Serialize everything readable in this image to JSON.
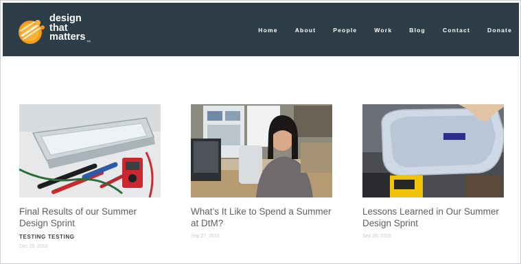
{
  "brand": {
    "logo_lines": [
      "design",
      "that",
      "matters"
    ],
    "trademark": "™"
  },
  "nav": {
    "items": [
      "Home",
      "About",
      "People",
      "Work",
      "Blog",
      "Contact",
      "Donate"
    ]
  },
  "posts": [
    {
      "title": "Final Results of our Summer Design Sprint",
      "tag": "TESTING TESTING",
      "date": "Dec 29, 2016",
      "image": "tray-and-multimeter-photo"
    },
    {
      "title": "What’s It Like to Spend a Summer at DtM?",
      "tag": "",
      "date": "Sep 27, 2016",
      "image": "intern-at-desk-photo"
    },
    {
      "title": "Lessons Learned in Our Summer Design Sprint",
      "tag": "",
      "date": "Sep 28, 2016",
      "image": "filled-tray-photo"
    }
  ],
  "colors": {
    "header_bg": "#2d3e48",
    "logo_orange": "#f49a1c",
    "nav_text": "#ffffff",
    "title_text": "#5b5f62"
  }
}
